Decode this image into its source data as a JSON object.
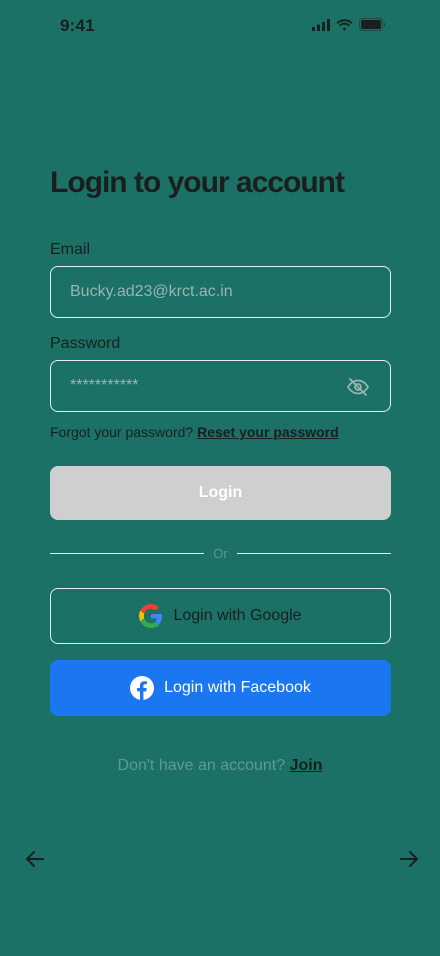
{
  "status_bar": {
    "time": "9:41"
  },
  "icons": {
    "signal": "signal-bars-icon",
    "wifi": "wifi-icon",
    "battery": "battery-icon",
    "eye": "eye-off-icon",
    "google": "google-g-icon",
    "facebook": "facebook-f-icon",
    "back": "arrow-left-icon",
    "next": "arrow-right-icon"
  },
  "colors": {
    "background": "#1b7166",
    "login_button": "#cfcfcf",
    "facebook_button": "#1a76f1",
    "muted_text": "#5e9a91"
  },
  "login": {
    "title": "Login to your account",
    "email_label": "Email",
    "email_value": "Bucky.ad23@krct.ac.in",
    "password_label": "Password",
    "password_value": "***********",
    "forgot_text": "Forgot your password?",
    "reset_link": "Reset your password",
    "login_button": "Login",
    "divider_text": "Or",
    "google_button": "Login with Google",
    "facebook_button": "Login with Facebook",
    "no_account_text": "Don't have an account?",
    "join_link": "Join"
  }
}
